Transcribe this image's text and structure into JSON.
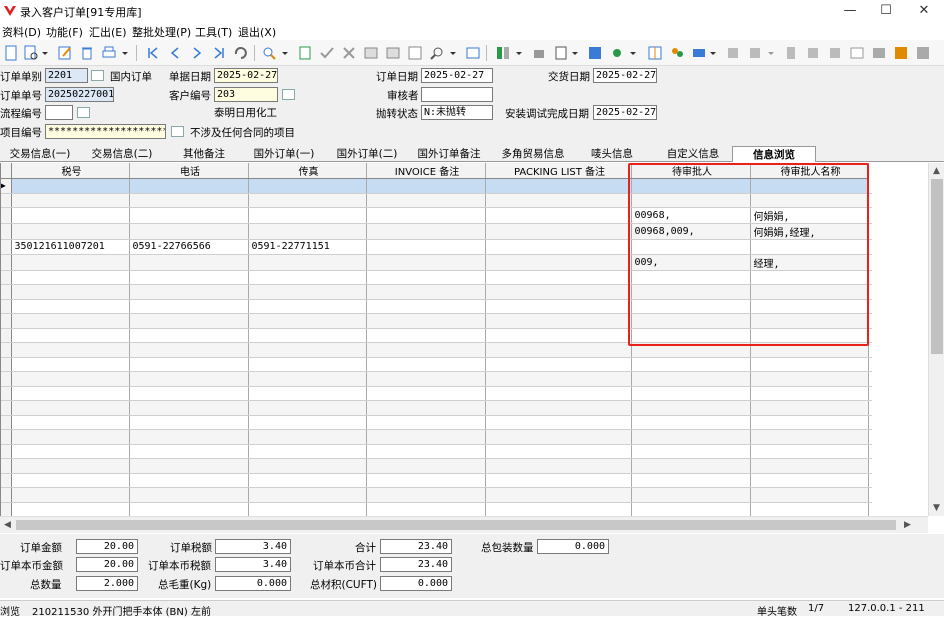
{
  "window": {
    "title": "录入客户订单[91专用库]",
    "minimize": "—",
    "maximize": "☐",
    "close": "✕"
  },
  "menu": [
    "资料(D)",
    "功能(F)",
    "汇出(E)",
    "整批处理(P)",
    "工具(T)",
    "退出(X)"
  ],
  "form": {
    "order_type_label": "订单单别",
    "order_type_value": "2201",
    "order_type_name": "国内订单",
    "doc_date_label": "单据日期",
    "doc_date_value": "2025-02-27",
    "order_date_label": "订单日期",
    "order_date_value": "2025-02-27",
    "delivery_date_label": "交货日期",
    "delivery_date_value": "2025-02-27",
    "order_no_label": "订单单号",
    "order_no_value": "20250227001",
    "customer_no_label": "客户编号",
    "customer_no_value": "203",
    "reviewer_label": "审核者",
    "reviewer_value": "",
    "customer_name": "泰明日用化工",
    "flow_no_label": "流程编号",
    "flow_no_value": "",
    "transfer_status_label": "抛转状态",
    "transfer_status_value": "N:未抛转",
    "install_date_label": "安装调试完成日期",
    "install_date_value": "2025-02-27",
    "project_no_label": "项目编号",
    "project_no_value": "*********************",
    "project_desc": "不涉及任何合同的项目"
  },
  "tabs": [
    "交易信息(一)",
    "交易信息(二)",
    "其他备注",
    "国外订单(一)",
    "国外订单(二)",
    "国外订单备注",
    "多角贸易信息",
    "唛头信息",
    "自定义信息",
    "信息浏览"
  ],
  "active_tab": "信息浏览",
  "grid": {
    "columns": [
      "税号",
      "电话",
      "传真",
      "INVOICE 备注",
      "PACKING LIST 备注",
      "待审批人",
      "待审批人名称"
    ],
    "rows": [
      [
        "",
        "",
        "",
        "",
        "",
        "",
        ""
      ],
      [
        "",
        "",
        "",
        "",
        "",
        "",
        ""
      ],
      [
        "",
        "",
        "",
        "",
        "",
        "00968,",
        "何娟娟,"
      ],
      [
        "",
        "",
        "",
        "",
        "",
        "00968,009,",
        "何娟娟,经理,"
      ],
      [
        "350121611007201",
        "0591-22766566",
        "0591-22771151",
        "",
        "",
        "",
        ""
      ],
      [
        "",
        "",
        "",
        "",
        "",
        "009,",
        "经理,"
      ]
    ]
  },
  "summary": {
    "order_amount_label": "订单金额",
    "order_amount": "20.00",
    "order_tax_label": "订单税额",
    "order_tax": "3.40",
    "total_label": "合计",
    "total": "23.40",
    "total_pack_label": "总包装数量",
    "total_pack": "0.000",
    "local_amount_label": "订单本币金额",
    "local_amount": "20.00",
    "local_tax_label": "订单本币税额",
    "local_tax": "3.40",
    "local_total_label": "订单本币合计",
    "local_total": "23.40",
    "total_qty_label": "总数量",
    "total_qty": "2.000",
    "gross_weight_label": "总毛重(Kg)",
    "gross_weight": "0.000",
    "total_volume_label": "总材积(CUFT)",
    "total_volume": "0.000"
  },
  "status": {
    "mode": "浏览",
    "item": "210211530 外开门把手本体 (BN) 左前",
    "count_label": "单头笔数",
    "count": "1/7",
    "ip": "127.0.0.1 - 211"
  }
}
